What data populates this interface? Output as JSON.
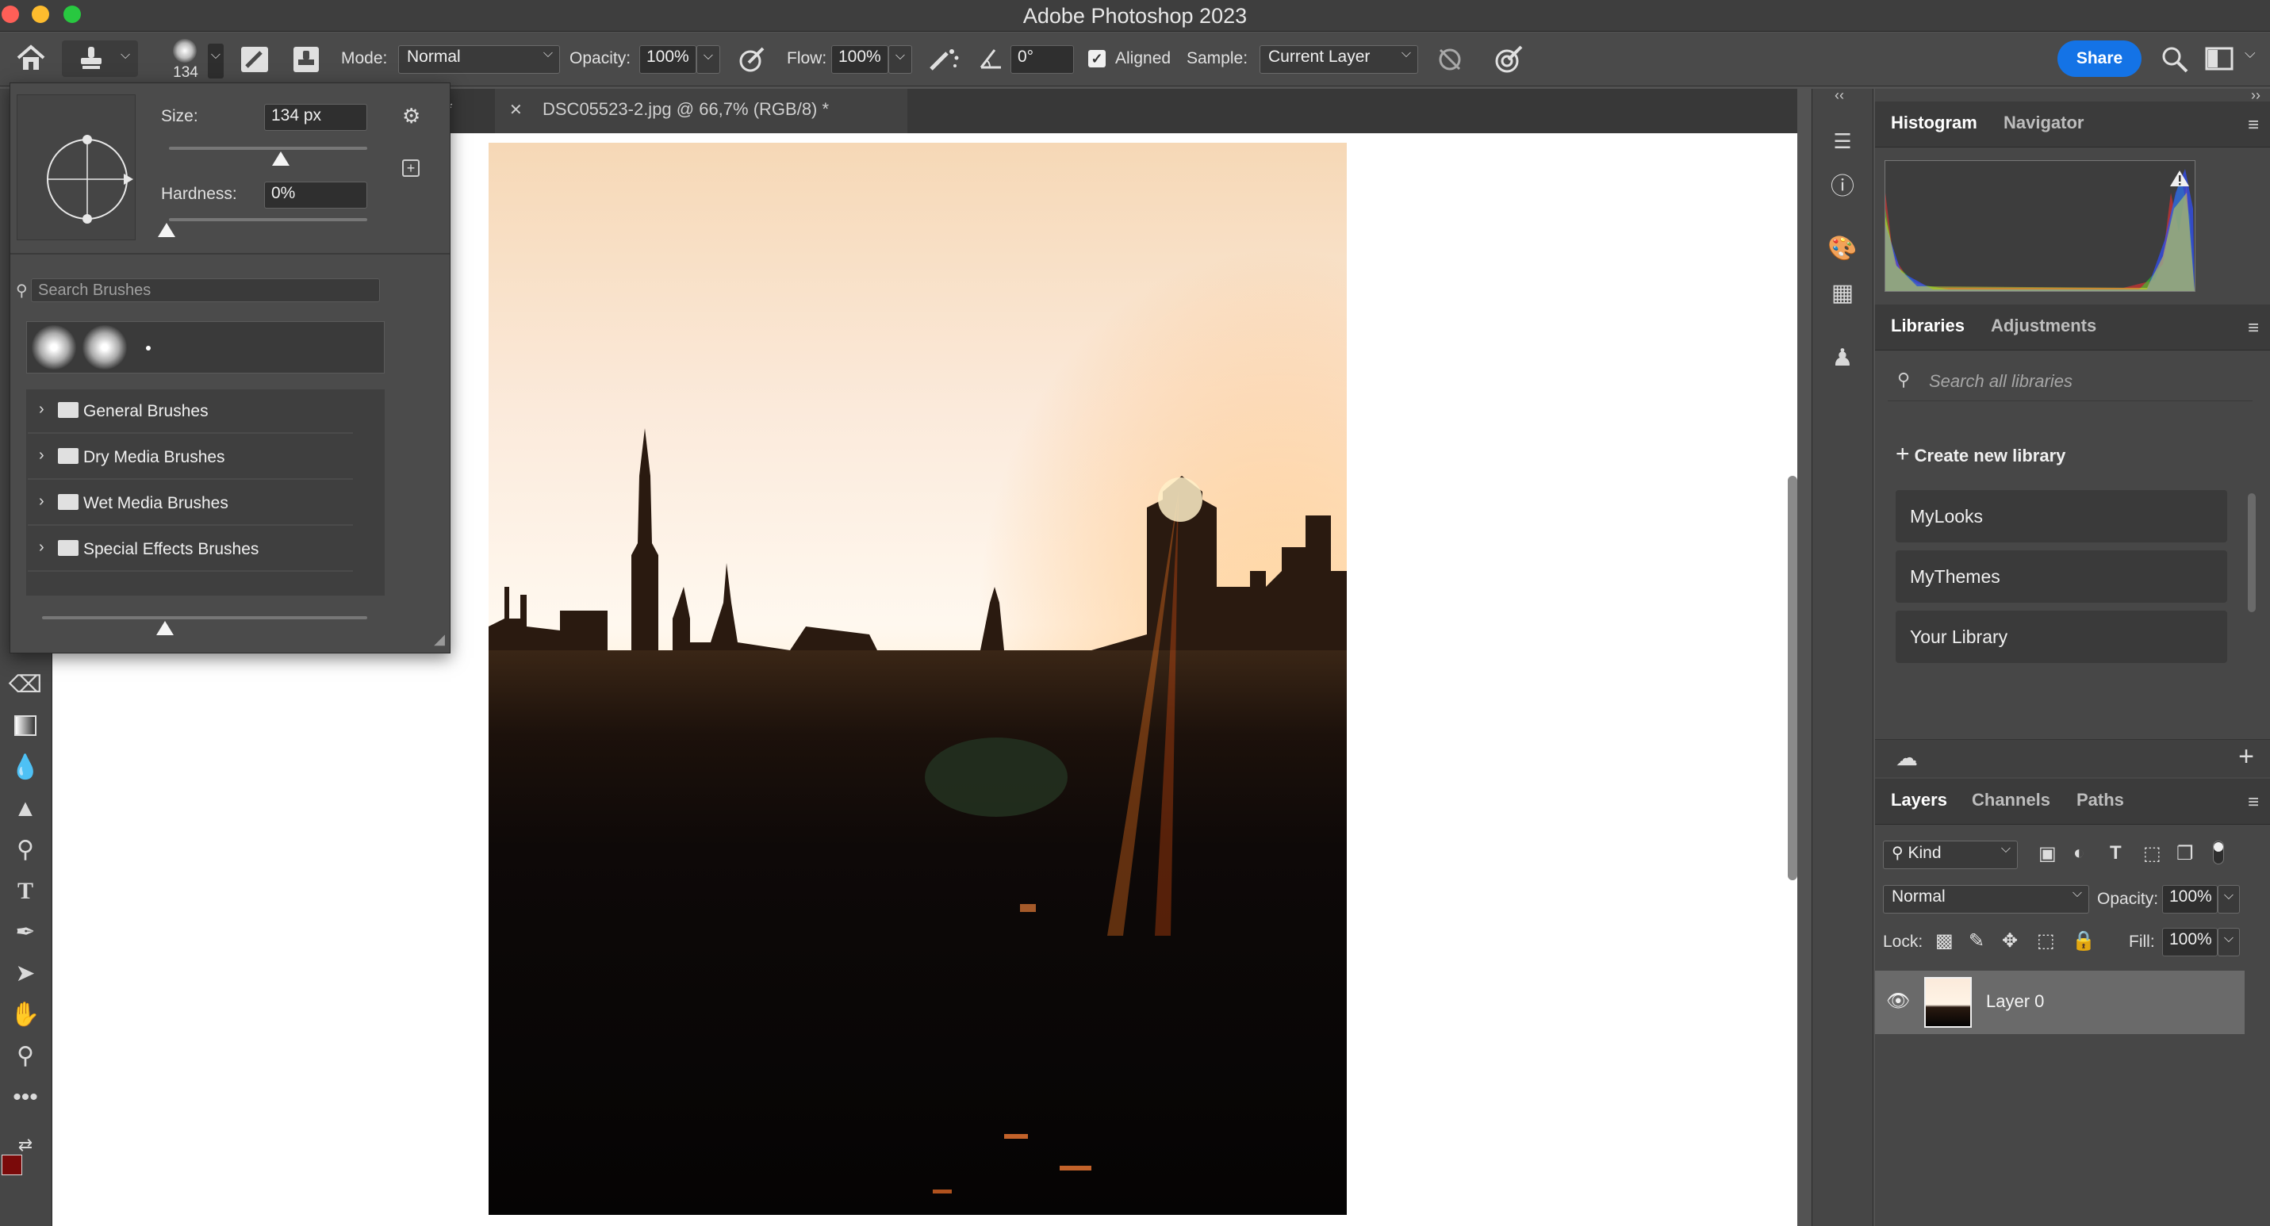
{
  "window": {
    "title": "Adobe Photoshop 2023",
    "traffic_colors": [
      "#fe5f57",
      "#febc2e",
      "#28c840"
    ]
  },
  "options": {
    "brush_size": "134",
    "mode_label": "Mode:",
    "mode_value": "Normal",
    "opacity_label": "Opacity:",
    "opacity_value": "100%",
    "flow_label": "Flow:",
    "flow_value": "100%",
    "angle_value": "0°",
    "aligned_label": "Aligned",
    "sample_label": "Sample:",
    "sample_value": "Current Layer",
    "share_label": "Share"
  },
  "document": {
    "tab_title": "DSC05523-2.jpg @ 66,7% (RGB/8) *",
    "prev_tab_suffix": "*"
  },
  "brush_popup": {
    "size_label": "Size:",
    "size_value": "134 px",
    "hardness_label": "Hardness:",
    "hardness_value": "0%",
    "search_placeholder": "Search Brushes",
    "folders": [
      {
        "label": "General Brushes"
      },
      {
        "label": "Dry Media Brushes"
      },
      {
        "label": "Wet Media Brushes"
      },
      {
        "label": "Special Effects Brushes"
      }
    ]
  },
  "panels": {
    "histogram_tabs": [
      "Histogram",
      "Navigator"
    ],
    "libraries_tabs": [
      "Libraries",
      "Adjustments"
    ],
    "libraries_search": "Search all libraries",
    "create_library": "Create new library",
    "libraries": [
      "MyLooks",
      "MyThemes",
      "Your Library"
    ],
    "layers_tabs": [
      "Layers",
      "Channels",
      "Paths"
    ],
    "kind_label": "Kind",
    "blend_mode": "Normal",
    "opacity_label": "Opacity:",
    "opacity_value": "100%",
    "lock_label": "Lock:",
    "fill_label": "Fill:",
    "fill_value": "100%",
    "layer_name": "Layer 0"
  },
  "colors": {
    "accent": "#1473e6",
    "foreground": "#7a0a0a",
    "background_swatch": "#ffffff"
  },
  "icons": [
    "home-icon",
    "clone-stamp-icon",
    "brush-settings-icon",
    "clone-source-icon",
    "airbrush-icon",
    "pressure-opacity-icon",
    "angle-icon",
    "ignore-adjustment-icon",
    "pressure-size-icon",
    "search-icon",
    "workspace-icon",
    "gear-icon"
  ]
}
